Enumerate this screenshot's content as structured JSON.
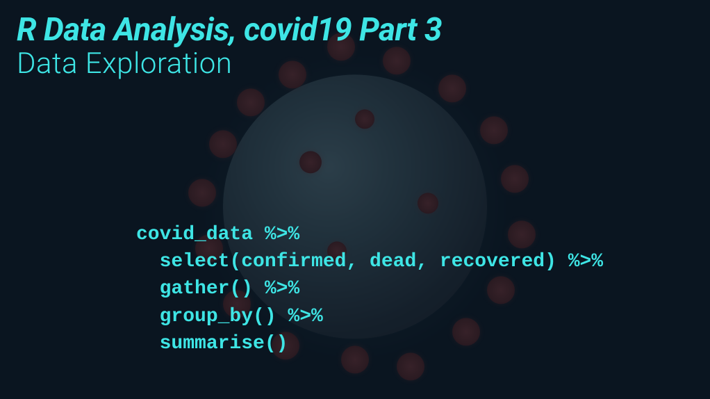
{
  "header": {
    "title": "R Data Analysis, covid19 Part 3",
    "subtitle": "Data Exploration"
  },
  "code": {
    "line1": "covid_data %>%",
    "line2": "  select(confirmed, dead, recovered) %>%",
    "line3": "  gather() %>%",
    "line4": "  group_by() %>%",
    "line5": "  summarise()"
  }
}
